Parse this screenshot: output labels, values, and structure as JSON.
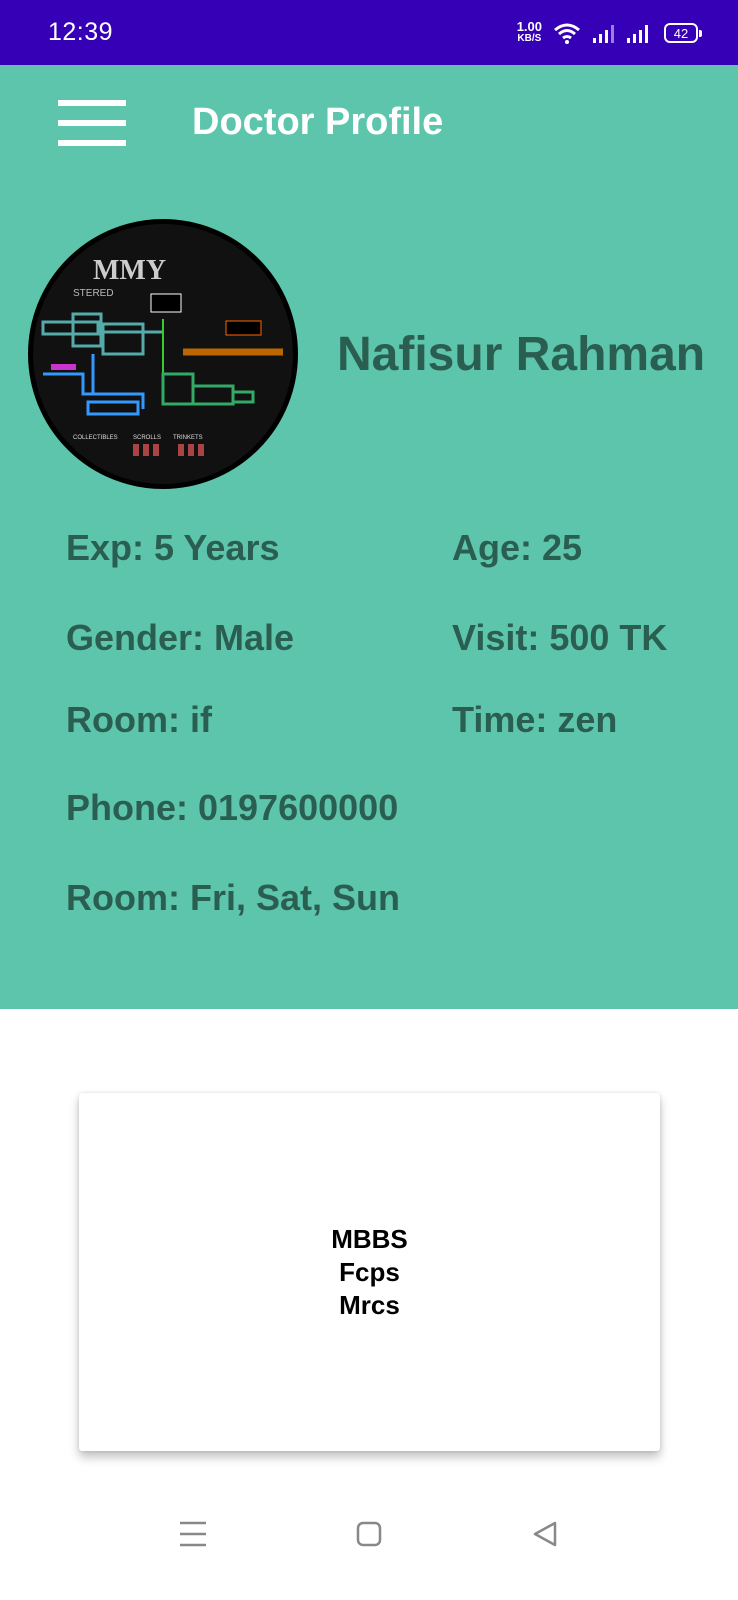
{
  "status_bar": {
    "time": "12:39",
    "net_speed_value": "1.00",
    "net_speed_unit": "KB/S",
    "battery": "42",
    "icons": [
      "wifi-icon",
      "signal-icon",
      "signal-icon",
      "battery-icon"
    ]
  },
  "toolbar": {
    "menu_icon": "menu-icon",
    "title": "Doctor Profile"
  },
  "doctor": {
    "name": "Nafisur Rahman",
    "exp": "Exp: 5 Years",
    "age": "Age: 25",
    "gender": "Gender: Male",
    "visit": "Visit: 500 TK",
    "room": "Room: if",
    "time": "Time: zen",
    "phone": "Phone: 0197600000",
    "days": "Room: Fri, Sat, Sun"
  },
  "avatar_image": {
    "title_text": "MMY",
    "subtitle_text": "STERED",
    "legend_labels": [
      "COLLECTIBLES",
      "SCROLLS",
      "TRINKETS"
    ]
  },
  "qualifications": [
    "MBBS",
    "Fcps",
    "Mrcs"
  ],
  "nav_bar": {
    "icons": [
      "recents-icon",
      "home-icon",
      "back-icon"
    ]
  },
  "colors": {
    "status_bar": "#3600b6",
    "header": "#5ec5ad",
    "text_dark": "#2a5e50"
  }
}
